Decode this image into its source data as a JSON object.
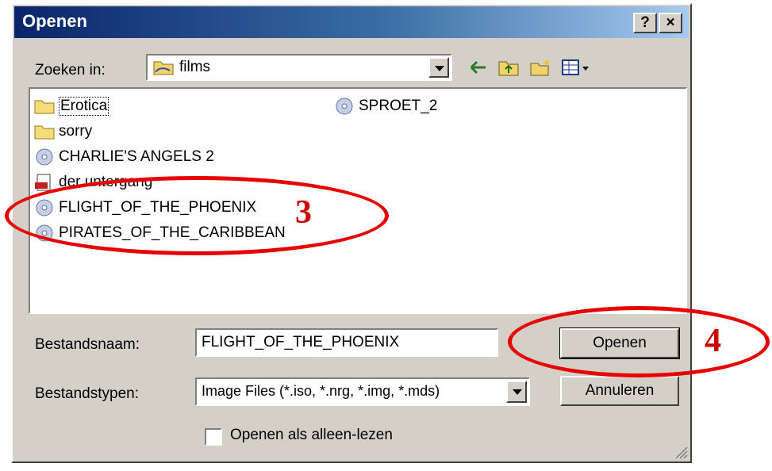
{
  "window": {
    "title": "Openen",
    "help_label": "?",
    "close_label": "×"
  },
  "look_in": {
    "label": "Zoeken in:",
    "value": "films"
  },
  "files": [
    {
      "name": "Erotica",
      "icon": "folder-icon"
    },
    {
      "name": "sorry",
      "icon": "folder-icon"
    },
    {
      "name": "CHARLIE'S ANGELS 2",
      "icon": "disc-image-icon"
    },
    {
      "name": "der untergang",
      "icon": "mds-file-icon"
    },
    {
      "name": "FLIGHT_OF_THE_PHOENIX",
      "icon": "disc-image-icon"
    },
    {
      "name": "PIRATES_OF_THE_CARIBBEAN",
      "icon": "disc-image-icon"
    },
    {
      "name": "SPROET_2",
      "icon": "disc-image-icon"
    }
  ],
  "filename": {
    "label": "Bestandsnaam:",
    "value": "FLIGHT_OF_THE_PHOENIX"
  },
  "filetype": {
    "label": "Bestandstypen:",
    "value": "Image Files (*.iso, *.nrg, *.img, *.mds)"
  },
  "buttons": {
    "open": "Openen",
    "cancel": "Annuleren"
  },
  "readonly": {
    "label": "Openen als alleen-lezen",
    "checked": false
  },
  "annotations": {
    "step3": "3",
    "step4": "4",
    "color": "#e60000"
  },
  "icons": {
    "folder": "folder-icon",
    "disc": "disc-image-icon",
    "back": "back-arrow-icon",
    "up": "up-folder-icon",
    "new_folder": "new-folder-icon",
    "views": "view-menu-icon"
  }
}
